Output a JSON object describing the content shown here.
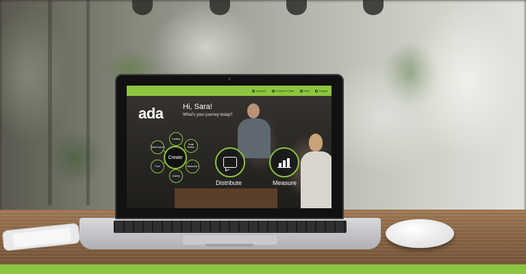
{
  "topbar": {
    "nav": [
      {
        "label": "Account",
        "icon": "user-icon"
      },
      {
        "label": "Customer Data",
        "icon": "database-icon"
      },
      {
        "label": "Help",
        "icon": "help-icon"
      },
      {
        "label": "Logout",
        "icon": "logout-icon"
      }
    ]
  },
  "brand": {
    "logo": "ada",
    "accent": "#8dc63f"
  },
  "greeting": {
    "title": "Hi, Sara!",
    "subtitle": "What's your journey today?"
  },
  "create_hub": {
    "center_label": "Create",
    "satellites": [
      "Landing",
      "Email Builder",
      "Subscriber",
      "Journey",
      "Form",
      "SalesContent"
    ]
  },
  "actions": {
    "distribute": "Distribute",
    "measure": "Measure"
  }
}
